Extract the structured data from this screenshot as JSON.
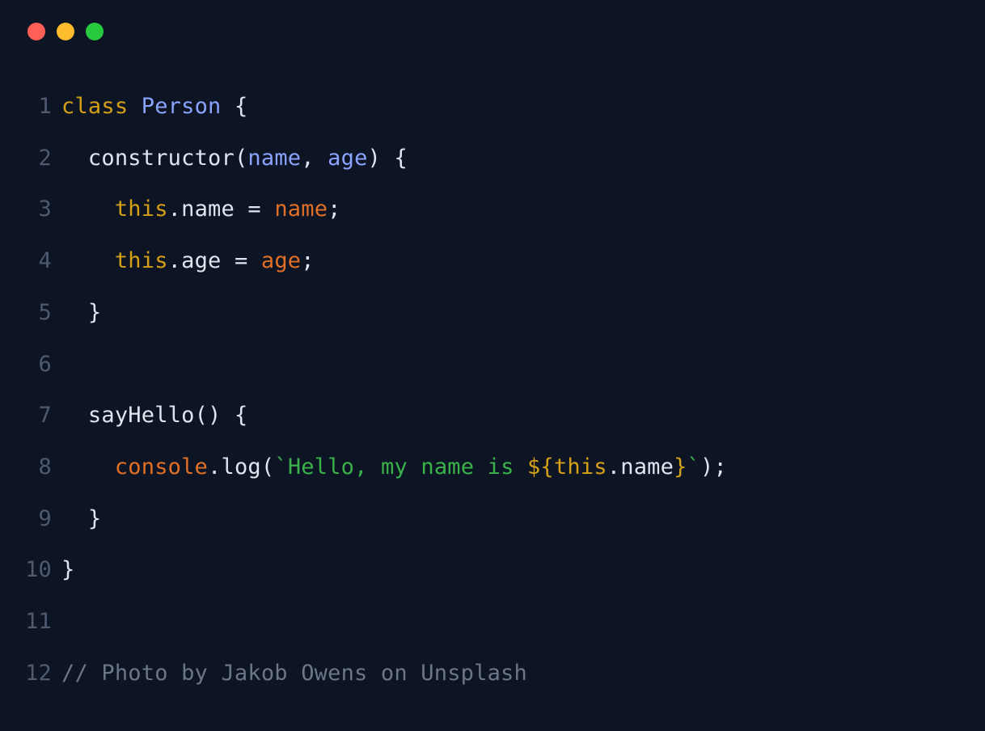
{
  "colors": {
    "background": "#0d1424",
    "gutter": "#4f5a70",
    "plain": "#e0e4ef",
    "keyword": "#d4a017",
    "identBlue": "#8aa3ff",
    "identOrange": "#e07028",
    "string": "#39b24a",
    "comment": "#6c7689",
    "traffic": {
      "red": "#ff5f56",
      "yellow": "#ffbd2e",
      "green": "#27c93f"
    }
  },
  "lineNumbers": [
    "1",
    "2",
    "3",
    "4",
    "5",
    "6",
    "7",
    "8",
    "9",
    "10",
    "11",
    "12"
  ],
  "code": {
    "l1": {
      "kw_class": "class",
      "sp1": " ",
      "cls_name": "Person",
      "sp2": " ",
      "brace": "{"
    },
    "l2": {
      "indent": "  ",
      "ctor": "constructor",
      "open": "(",
      "p1": "name",
      "comma": ", ",
      "p2": "age",
      "close": ")",
      "sp": " ",
      "brace": "{"
    },
    "l3": {
      "indent": "    ",
      "this": "this",
      "dot": ".",
      "prop": "name",
      "eq": " = ",
      "val": "name",
      "semi": ";"
    },
    "l4": {
      "indent": "    ",
      "this": "this",
      "dot": ".",
      "prop": "age",
      "eq": " = ",
      "val": "age",
      "semi": ";"
    },
    "l5": {
      "indent": "  ",
      "brace": "}"
    },
    "l6": {
      "blank": ""
    },
    "l7": {
      "indent": "  ",
      "name": "sayHello",
      "parens": "() ",
      "brace": "{"
    },
    "l8": {
      "indent": "    ",
      "console": "console",
      "dot": ".",
      "log": "log",
      "open": "(",
      "tick1": "`",
      "str1": "Hello, my name is ",
      "iopen": "${",
      "this": "this",
      "idot": ".",
      "iprop": "name",
      "iclose": "}",
      "tick2": "`",
      "close": ")",
      "semi": ";"
    },
    "l9": {
      "indent": "  ",
      "brace": "}"
    },
    "l10": {
      "brace": "}"
    },
    "l11": {
      "blank": ""
    },
    "l12": {
      "comment": "// Photo by Jakob Owens on Unsplash"
    }
  }
}
